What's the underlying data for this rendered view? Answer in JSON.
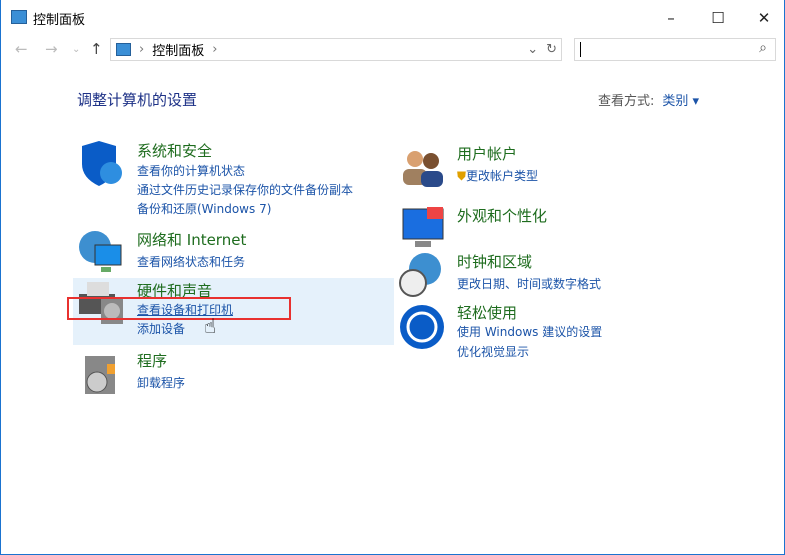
{
  "window": {
    "title": "控制面板",
    "minimize": "–",
    "maximize": "☐",
    "close": "✕"
  },
  "nav": {
    "back": "←",
    "forward": "→",
    "recent": "⌄",
    "up": "↑"
  },
  "address": {
    "sep": "›",
    "crumb": "控制面板",
    "dropdown": "⌄",
    "refresh": "↻"
  },
  "search": {
    "placeholder": "",
    "icon": "⌕"
  },
  "heading": "调整计算机的设置",
  "view": {
    "label": "查看方式:",
    "value": "类别 ▾"
  },
  "categories": [
    {
      "title": "系统和安全",
      "links": [
        "查看你的计算机状态",
        "通过文件历史记录保存你的文件备份副本",
        "备份和还原(Windows 7)"
      ]
    },
    {
      "title": "网络和 Internet",
      "links": [
        "查看网络状态和任务"
      ]
    },
    {
      "title": "硬件和声音",
      "links": [
        "查看设备和打印机",
        "添加设备"
      ]
    },
    {
      "title": "程序",
      "links": [
        "卸载程序"
      ]
    },
    {
      "title": "用户帐户",
      "links": [
        "更改帐户类型"
      ]
    },
    {
      "title": "外观和个性化",
      "links": []
    },
    {
      "title": "时钟和区域",
      "links": [
        "更改日期、时间或数字格式"
      ]
    },
    {
      "title": "轻松使用",
      "links": [
        "使用 Windows 建议的设置",
        "优化视觉显示"
      ]
    }
  ]
}
